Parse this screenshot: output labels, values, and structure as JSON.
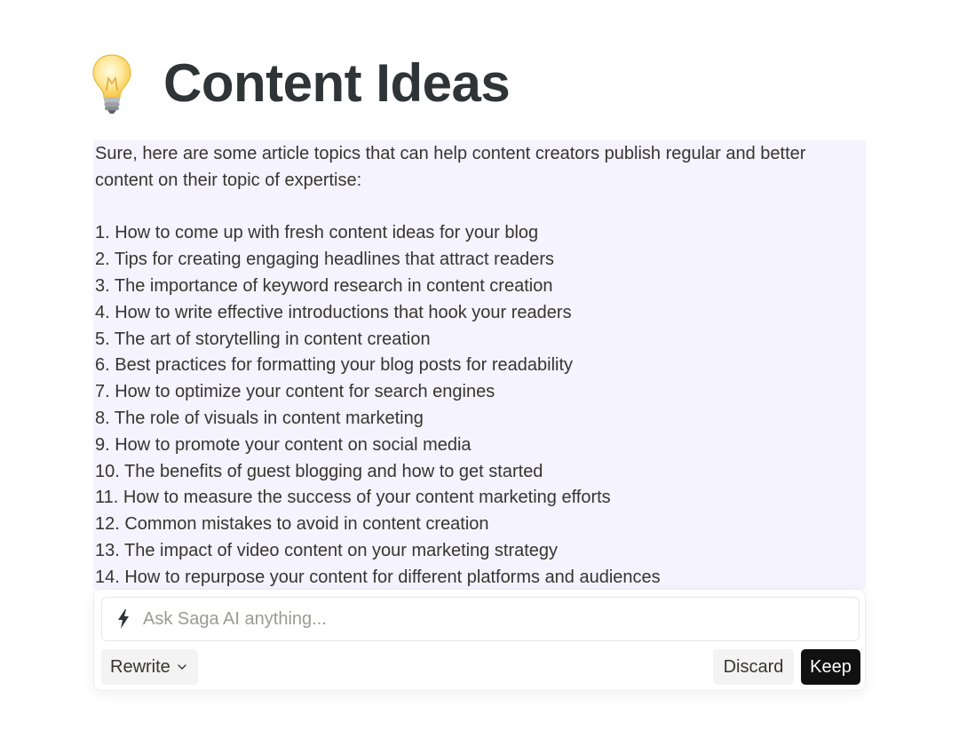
{
  "page": {
    "icon": "lightbulb-icon",
    "title": "Content Ideas"
  },
  "ai_response": {
    "intro": "Sure, here are some article topics that can help content creators publish regular and better content on their topic of expertise:",
    "items": [
      "1. How to come up with fresh content ideas for your blog",
      "2. Tips for creating engaging headlines that attract readers",
      "3. The importance of keyword research in content creation",
      "4. How to write effective introductions that hook your readers",
      "5. The art of storytelling in content creation",
      "6. Best practices for formatting your blog posts for readability",
      "7. How to optimize your content for search engines",
      "8. The role of visuals in content marketing",
      "9. How to promote your content on social media",
      "10. The benefits of guest blogging and how to get started",
      "11. How to measure the success of your content marketing efforts",
      "12. Common mistakes to avoid in content creation",
      "13. The impact of video content on your marketing strategy",
      "14. How to repurpose your content for different platforms and audiences"
    ],
    "highlight_color": "#f4f3fe"
  },
  "prompt_bar": {
    "icon": "lightning-bolt-icon",
    "placeholder": "Ask Saga AI anything...",
    "value": ""
  },
  "actions": {
    "rewrite_label": "Rewrite",
    "rewrite_icon": "chevron-down-icon",
    "discard_label": "Discard",
    "keep_label": "Keep",
    "keep_color": "#111111"
  }
}
